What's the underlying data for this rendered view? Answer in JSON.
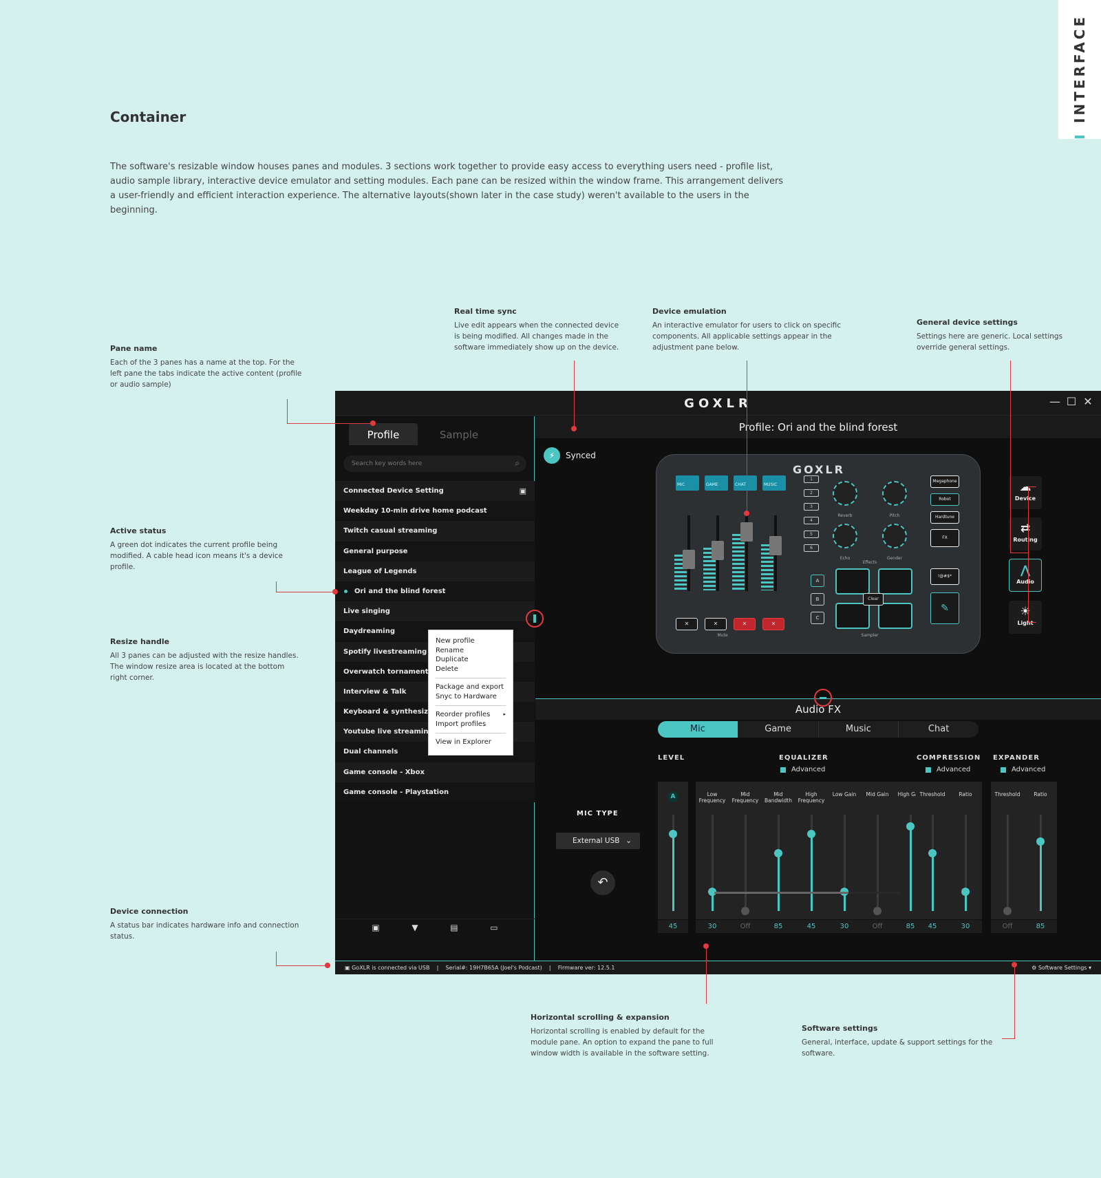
{
  "side_tab": "INTERFACE",
  "heading": "Container",
  "intro": "The software's resizable window houses panes and modules. 3 sections work together to provide easy access to everything users need - profile list, audio sample library, interactive device emulator and setting modules. Each pane can be resized within the window frame. This arrangement delivers a user-friendly and efficient interaction experience. The alternative layouts(shown later in the case study) weren't available to the users in the beginning.",
  "notes": {
    "pane_name": {
      "title": "Pane name",
      "text": "Each of the 3 panes has a name at the top. For the left pane the tabs indicate the active content (profile or audio sample)"
    },
    "real_time_sync": {
      "title": "Real time sync",
      "text": "Live edit appears when the connected device is being modified. All changes made in the software immediately show up on the device."
    },
    "device_emulation": {
      "title": "Device emulation",
      "text": "An interactive emulator for users to click on specific components. All applicable settings appear in the adjustment pane below."
    },
    "general_settings": {
      "title": "General device settings",
      "text": "Settings here are generic. Local settings override general settings."
    },
    "active_status": {
      "title": "Active status",
      "text": "A green dot indicates the current profile being modified. A cable head icon means it's a device profile."
    },
    "resize_handle": {
      "title": "Resize handle",
      "text": "All 3 panes can be adjusted with the resize handles. The window resize area is located at the bottom right corner."
    },
    "device_connection": {
      "title": "Device connection",
      "text": "A status bar indicates hardware info and connection status."
    },
    "horizontal_scrolling": {
      "title": "Horizontal scrolling & expansion",
      "text": "Horizontal scrolling is enabled by default for the module pane. An option to expand the pane to full window width is available in the software setting."
    },
    "software_settings": {
      "title": "Software settings",
      "text": "General, interface, update & support settings for the software."
    }
  },
  "app": {
    "logo": "GOXLR",
    "window_controls": [
      "—",
      "☐",
      "✕"
    ],
    "left_tabs": {
      "profile": "Profile",
      "sample": "Sample"
    },
    "search_placeholder": "Search key words here",
    "profiles": [
      "Connected Device Setting",
      "Weekday 10-min drive home podcast",
      "Twitch casual streaming",
      "General purpose",
      "League of Legends",
      "Ori and the blind forest",
      "Live singing",
      "Daydreaming",
      "Spotify livestreaming",
      "Overwatch tornament",
      "Interview & Talk",
      "Keyboard & synthesizer & s",
      "Youtube live streaming",
      "Dual channels",
      "Game console - Xbox",
      "Game console - Playstation"
    ],
    "active_profile_index": 5,
    "context_menu": {
      "group1": [
        "New profile",
        "Rename",
        "Duplicate",
        "Delete"
      ],
      "group2": [
        "Package and export",
        "Snyc to Hardware"
      ],
      "group3": [
        "Reorder profiles",
        "Import profiles"
      ],
      "group4": [
        "View in Explorer"
      ],
      "submenu_arrow": "▸"
    },
    "profile_header": "Profile: Ori and the blind forest",
    "sync_label": "Synced",
    "device": {
      "logo": "GOXLR",
      "screens": [
        "MIC",
        "GAME",
        "CHAT",
        "MUSIC"
      ],
      "number_buttons": [
        "1",
        "2",
        "3",
        "4",
        "5",
        "6"
      ],
      "knob_labels": [
        "Reverb",
        "Pitch",
        "Echo",
        "Gender"
      ],
      "effects_label": "Effects",
      "mute_label": "Mute",
      "sampler_label": "Sampler",
      "fx_buttons": [
        "Megaphone",
        "Robot",
        "Hardtune",
        "FX"
      ],
      "bank_buttons": [
        "A",
        "B",
        "C"
      ],
      "clear_label": "Clear",
      "bleep_label": "!@#$*"
    },
    "side_nav": [
      {
        "label": "Device",
        "icon": "☁"
      },
      {
        "label": "Routing",
        "icon": "⇄"
      },
      {
        "label": "Audio",
        "icon": "⋀"
      },
      {
        "label": "Light",
        "icon": "☀"
      }
    ],
    "active_side_nav": "Audio",
    "fx_header": "Audio FX",
    "fx_tabs": [
      "Mic",
      "Game",
      "Music",
      "Chat"
    ],
    "active_fx_tab": "Mic",
    "mic_type_label": "MIC TYPE",
    "mic_type_value": "External USB",
    "groups": {
      "level": "LEVEL",
      "equalizer": "EQUALIZER",
      "compression": "COMPRESSION",
      "expander": "EXPANDER",
      "advanced": "Advanced"
    },
    "level_badge": "A",
    "sliders": {
      "level": [
        {
          "label": "",
          "value": "45",
          "level": 0.8
        }
      ],
      "equalizer": [
        {
          "label": "Low Frequency",
          "value": "30",
          "level": 0.2
        },
        {
          "label": "Mid Frequency",
          "value": "Off",
          "level": 0.0
        },
        {
          "label": "Mid Bandwidth",
          "value": "85",
          "level": 0.6
        },
        {
          "label": "High Frequency",
          "value": "45",
          "level": 0.8
        },
        {
          "label": "Low Gain",
          "value": "30",
          "level": 0.2
        },
        {
          "label": "Mid Gain",
          "value": "Off",
          "level": 0.0
        },
        {
          "label": "High Gain",
          "value": "85",
          "level": 0.88
        }
      ],
      "compression": [
        {
          "label": "Threshold",
          "value": "45",
          "level": 0.6
        },
        {
          "label": "Ratio",
          "value": "30",
          "level": 0.2
        }
      ],
      "expander": [
        {
          "label": "Threshold",
          "value": "Off",
          "level": 0.0
        },
        {
          "label": "Ratio",
          "value": "85",
          "level": 0.72
        }
      ]
    },
    "status_bar": "GoXLR is connected via USB    |    Serial#: 19H7B65A (Joel's Podcast)    |    Firmware ver: 12.5.1",
    "software_settings": "Software Settings",
    "accent_color": "#4bc6c2",
    "annotation_color": "#e0393e"
  }
}
